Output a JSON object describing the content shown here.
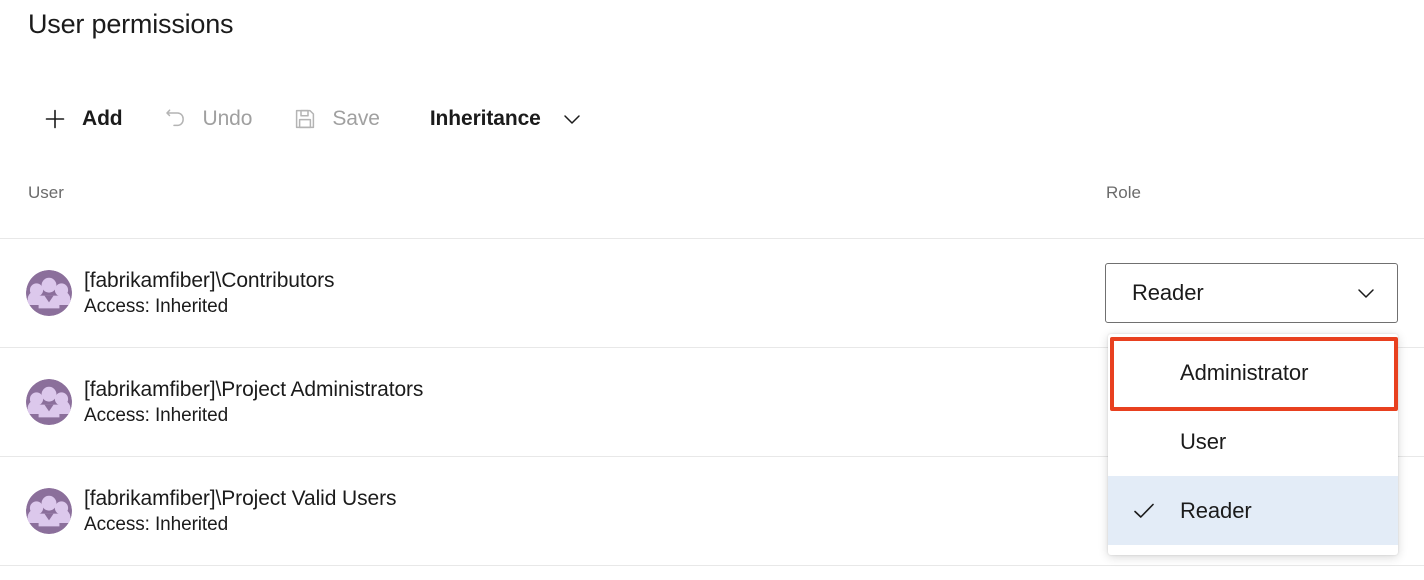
{
  "page": {
    "title": "User permissions"
  },
  "toolbar": {
    "items": [
      {
        "id": "add",
        "label": "Add",
        "icon": "plus-icon",
        "disabled": false
      },
      {
        "id": "undo",
        "label": "Undo",
        "icon": "undo-icon",
        "disabled": true
      },
      {
        "id": "save",
        "label": "Save",
        "icon": "save-floppy-icon",
        "disabled": true
      },
      {
        "id": "inheritance",
        "label": "Inheritance",
        "icon": "chevron-down-icon",
        "disabled": false
      }
    ]
  },
  "table": {
    "columns": {
      "user": "User",
      "role": "Role"
    },
    "rows": [
      {
        "avatar_icon": "group-avatar-icon",
        "name": "[fabrikamfiber]\\Contributors",
        "access": "Access: Inherited"
      },
      {
        "avatar_icon": "group-avatar-icon",
        "name": "[fabrikamfiber]\\Project Administrators",
        "access": "Access: Inherited"
      },
      {
        "avatar_icon": "group-avatar-icon",
        "name": "[fabrikamfiber]\\Project Valid Users",
        "access": "Access: Inherited"
      }
    ]
  },
  "role_combo": {
    "value": "Reader",
    "chevron_icon": "chevron-down-icon",
    "expanded": true,
    "options": [
      {
        "label": "Administrator",
        "selected": false,
        "highlighted": true
      },
      {
        "label": "User",
        "selected": false,
        "highlighted": false
      },
      {
        "label": "Reader",
        "selected": true,
        "highlighted": false
      }
    ]
  },
  "colors": {
    "highlight_red": "#e8401f",
    "selected_row_blue": "#e3ecf7",
    "avatar_purple": "#8b6f9b",
    "avatar_light": "#dcc8ec",
    "text_primary": "#1b1b1b",
    "text_muted": "#6b6b6b",
    "disabled_text": "#a0a0a0",
    "rule": "#e8e8e8"
  }
}
